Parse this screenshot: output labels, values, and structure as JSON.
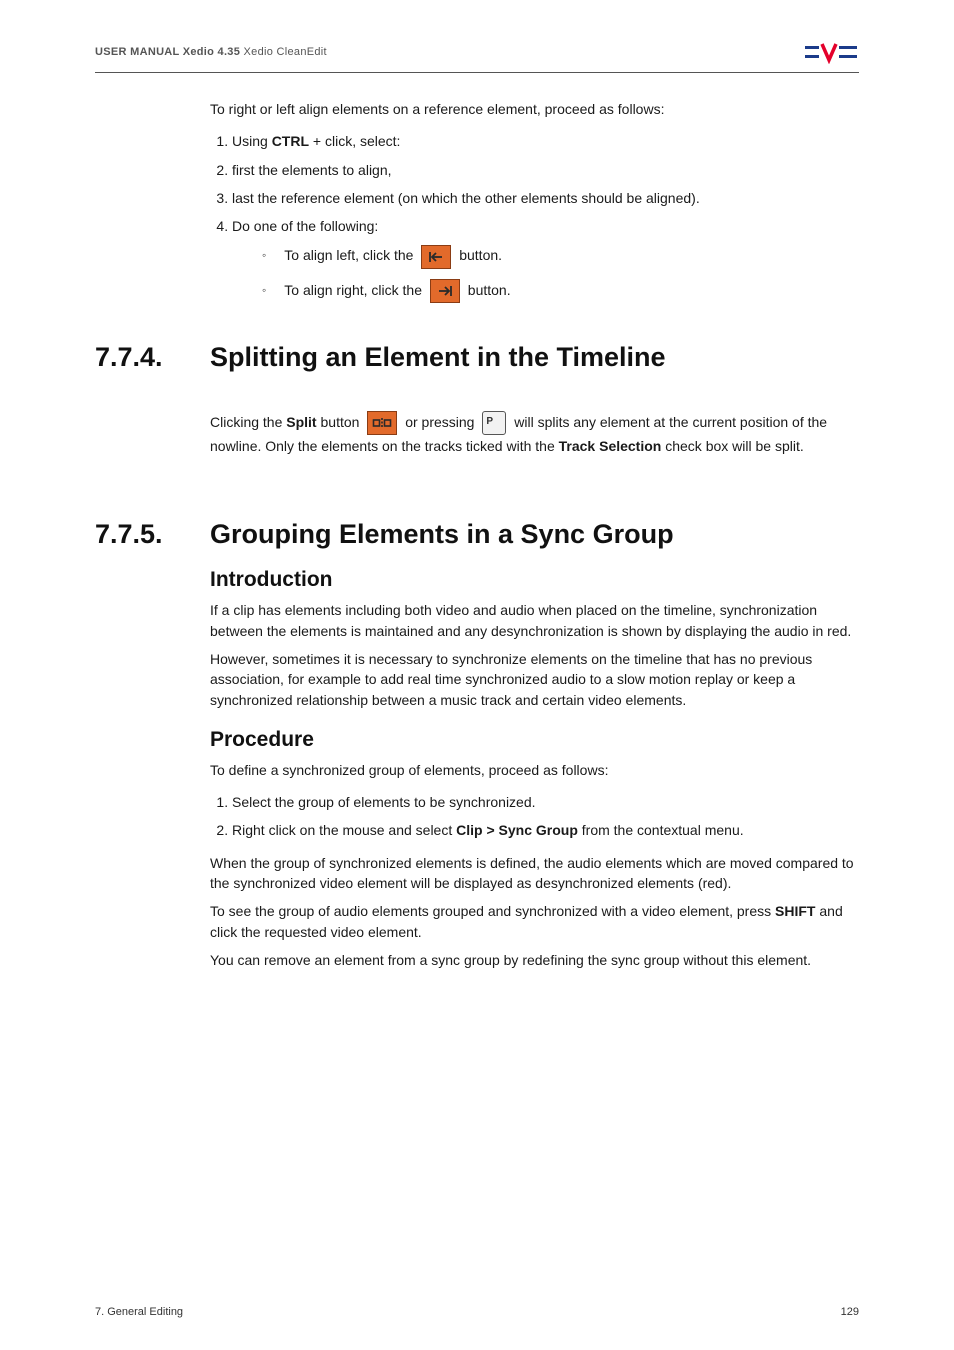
{
  "header": {
    "bold": "USER MANUAL Xedio 4.35",
    "light": " Xedio CleanEdit"
  },
  "intro": {
    "lead": "To right or left align elements on a reference element, proceed as follows:",
    "steps": [
      "Using CTRL + click, select:",
      "first the elements to align,",
      "last the reference element (on which the other elements should be aligned).",
      "Do one of the following:"
    ],
    "sub": {
      "left_pre": "To align left, click the ",
      "left_post": " button.",
      "right_pre": "To align right, click the ",
      "right_post": " button."
    },
    "step1_pre": "Using ",
    "step1_bold": "CTRL",
    "step1_post": " + click, select:"
  },
  "sec774": {
    "num": "7.7.4.",
    "title": "Splitting an Element in the Timeline",
    "para_pre": "Clicking the ",
    "para_bold1": "Split",
    "para_mid1": " button ",
    "para_mid2": " or pressing ",
    "para_mid3": " will splits any element at the current position of the nowline. Only the elements on the tracks ticked with the ",
    "para_bold2": "Track Selection",
    "para_post": " check box will be split.",
    "key_label": "P"
  },
  "sec775": {
    "num": "7.7.5.",
    "title": "Grouping Elements in a Sync Group",
    "h_intro": "Introduction",
    "p1": "If a clip has elements including both video and audio when placed on the timeline, synchronization between the elements is maintained and any desynchronization is shown by displaying the audio in red.",
    "p2": "However, sometimes it is necessary to synchronize elements on the timeline that has no previous association, for example to add real time synchronized audio to a slow motion replay or keep a synchronized relationship between a music track and certain video elements.",
    "h_proc": "Procedure",
    "proc_lead": "To define a synchronized group of elements, proceed as follows:",
    "proc_steps": {
      "s1": "Select the group of elements to be synchronized.",
      "s2_pre": "Right click on the mouse and select ",
      "s2_bold": "Clip > Sync Group",
      "s2_post": " from the contextual menu."
    },
    "p3": "When the group of synchronized elements is defined, the audio elements which are moved compared to the synchronized video element will be displayed as desynchronized elements (red).",
    "p4_pre": "To see the group of audio elements grouped and synchronized with a video element, press ",
    "p4_bold": "SHIFT",
    "p4_post": " and click the requested video element.",
    "p5": "You can remove an element from a sync group by redefining the sync group without this element."
  },
  "footer": {
    "left": "7. General Editing",
    "right": "129"
  }
}
